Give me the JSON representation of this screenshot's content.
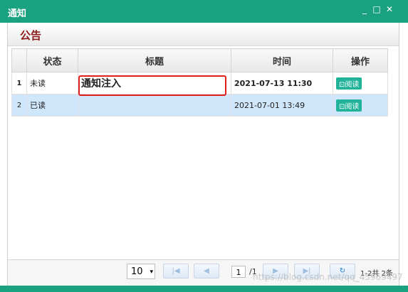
{
  "window": {
    "title": "通知",
    "min_glyph": "_",
    "max_glyph": "□",
    "close_glyph": "✕"
  },
  "panel": {
    "title": "公告"
  },
  "table": {
    "headers": [
      "状态",
      "标题",
      "时间",
      "操作"
    ],
    "rows": [
      {
        "num": "1",
        "status": "未读",
        "title": "通知注入",
        "time": "2021-07-13 11:30",
        "action": "阅读"
      },
      {
        "num": "2",
        "status": "已读",
        "title": "",
        "time": "2021-07-01 13:49",
        "action": "阅读"
      }
    ]
  },
  "pager": {
    "page_size": "10",
    "page": "1",
    "total_pages": "/1",
    "info": "1-2共 2条"
  },
  "watermark": "https://blog.csdn.net/qq_45969497",
  "colors": {
    "titlebar": "#1aa180",
    "panel_title": "#8b1b1b",
    "highlight": "#e02020",
    "selected_row": "#cfe6fb"
  }
}
